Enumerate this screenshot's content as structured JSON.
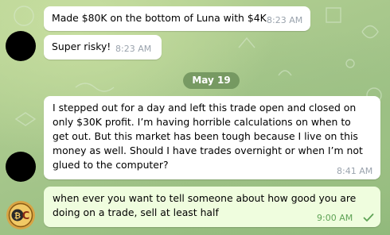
{
  "date_separator": "May 19",
  "messages": [
    {
      "text": "Made $80K on the bottom of Luna with $4K",
      "time": "8:23 AM"
    },
    {
      "text": "Super risky!",
      "time": "8:23 AM"
    },
    {
      "text": "I stepped out for a day and left this trade open and closed on only $30K profit. I’m having horrible calculations on when to get out. But this market has been tough because I live on this money as well. Should I have trades overnight or when I’m not glued to the computer?",
      "time": "8:41 AM"
    },
    {
      "text": "when ever you want to tell someone about how good you are doing on a trade, sell at least half",
      "time": "9:00 AM",
      "status": "read"
    }
  ],
  "colors": {
    "chat_background": "#a9c98c",
    "incoming_bubble": "#ffffff",
    "outgoing_bubble": "#effdde",
    "read_check": "#5fa356",
    "date_pill": "#688c56"
  },
  "avatar_icon": "bitcoin-coin-icon"
}
